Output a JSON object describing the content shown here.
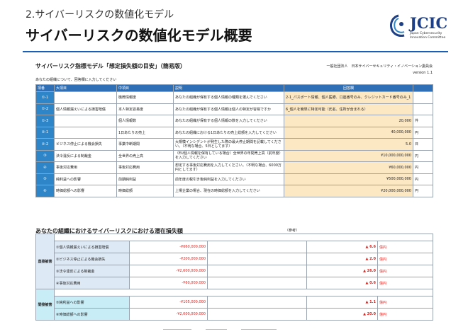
{
  "slide": {
    "subtitle": "2.サイバーリスクの数値化モデル",
    "title": "サイバーリスクの数値化モデル概要",
    "logo": {
      "word": "JCIC",
      "sub_line1": "Japan Cybersecurity",
      "sub_line2": "Innovation Committee",
      "colors": {
        "primary": "#1d3f86",
        "accent": "#2e86c8"
      }
    }
  },
  "sheet": {
    "title": "サイバーリスク指標モデル「想定損失額の目安」（簡易版）",
    "org": "一般社団法人　日本サイバーセキュリティ・イノベーション委員会",
    "version": "version 1.1",
    "note": "あなたの組織について、回答欄に入力してください",
    "headers": [
      "項番",
      "大項目",
      "中項目",
      "説明",
      "回答欄",
      ""
    ],
    "rows": [
      {
        "id": "①-1",
        "cat": "",
        "sub": "機微情報度",
        "desc": "あなたの組織が保有する個人情報の種類を選んでください",
        "ans": "2-1_パスポート情報、個人医療、口座番号のみ、クレジットカード番号のみ_1",
        "unit": ""
      },
      {
        "id": "①-2",
        "cat": "個人情報漏えいによる損害賠償",
        "sub": "本人特定容易度",
        "desc": "あなたの組織が保有する個人情報は個人の特定が容易ですか",
        "ans": "6_個人を簡単に特定可能（氏名、住所が含まれる）",
        "unit": ""
      },
      {
        "id": "①-3",
        "cat": "",
        "sub": "個人情報数",
        "desc": "あなたの組織が保有する個人情報の数を入力してください",
        "ans": "20,000",
        "unit": "件"
      },
      {
        "id": "②-1",
        "cat": "",
        "sub": "1日あたりの売上",
        "desc": "あなたの組織における1日あたりの売上総額を入力してください",
        "ans": "40,000,000",
        "unit": "円"
      },
      {
        "id": "②-2",
        "cat": "ビジネス停止による機会損失",
        "sub": "事業中断期間",
        "desc": "大規模インシデントが発生した際の最大停止期間を記載してください。（不明な場合、5日としてます）",
        "ans": "5.0",
        "unit": "日"
      },
      {
        "id": "③",
        "cat": "法令違反による制裁金",
        "sub": "全世界の売上高",
        "desc": "（EU個人情報を保有している場合）全世界の年間売上高（前年度）を入力してください",
        "ans": "¥10,000,000,000",
        "unit": "円"
      },
      {
        "id": "④",
        "cat": "事後対応費用",
        "sub": "事後対応費用",
        "desc": "想定する事後対応費用を入力してください。（不明な場合、6000万円としてます）",
        "ans": "¥60,000,000",
        "unit": "円"
      },
      {
        "id": "⑤",
        "cat": "純利益への影響",
        "sub": "前期純利益",
        "desc": "前年度の税引き後純利益を入力してください",
        "ans": "¥500,000,000",
        "unit": "円"
      },
      {
        "id": "⑥",
        "cat": "時価総額への影響",
        "sub": "時価総額",
        "desc": "上場企業の場合、現在の時価総額を入力してください",
        "ans": "¥20,000,000,000",
        "unit": "円"
      }
    ]
  },
  "result": {
    "title": "あなたの組織におけるサイバーリスクにおける潜在損失額",
    "ref_label": "（参考）",
    "groups": [
      {
        "label": "直接被害",
        "items": [
          {
            "name": "①個人情報漏えいによる損害賠償",
            "value": "-¥660,000,000",
            "pct": "▲ 6.6",
            "unit": "億円"
          },
          {
            "name": "②ビジネス停止による機会損失",
            "value": "-¥200,000,000",
            "pct": "▲ 2.0",
            "unit": "億円"
          },
          {
            "name": "③法令違反による制裁金",
            "value": "-¥2,600,000,000",
            "pct": "▲ 26.0",
            "unit": "億円"
          },
          {
            "name": "④事後対応費用",
            "value": "-¥60,000,000",
            "pct": "▲ 0.6",
            "unit": "億円"
          }
        ]
      },
      {
        "label": "間接被害",
        "items": [
          {
            "name": "⑤純利益への影響",
            "value": "-¥105,000,000",
            "pct": "▲ 1.1",
            "unit": "億円"
          },
          {
            "name": "⑥時価総額への影響",
            "value": "-¥2,000,000,000",
            "pct": "▲ 20.0",
            "unit": "億円"
          }
        ]
      }
    ]
  }
}
